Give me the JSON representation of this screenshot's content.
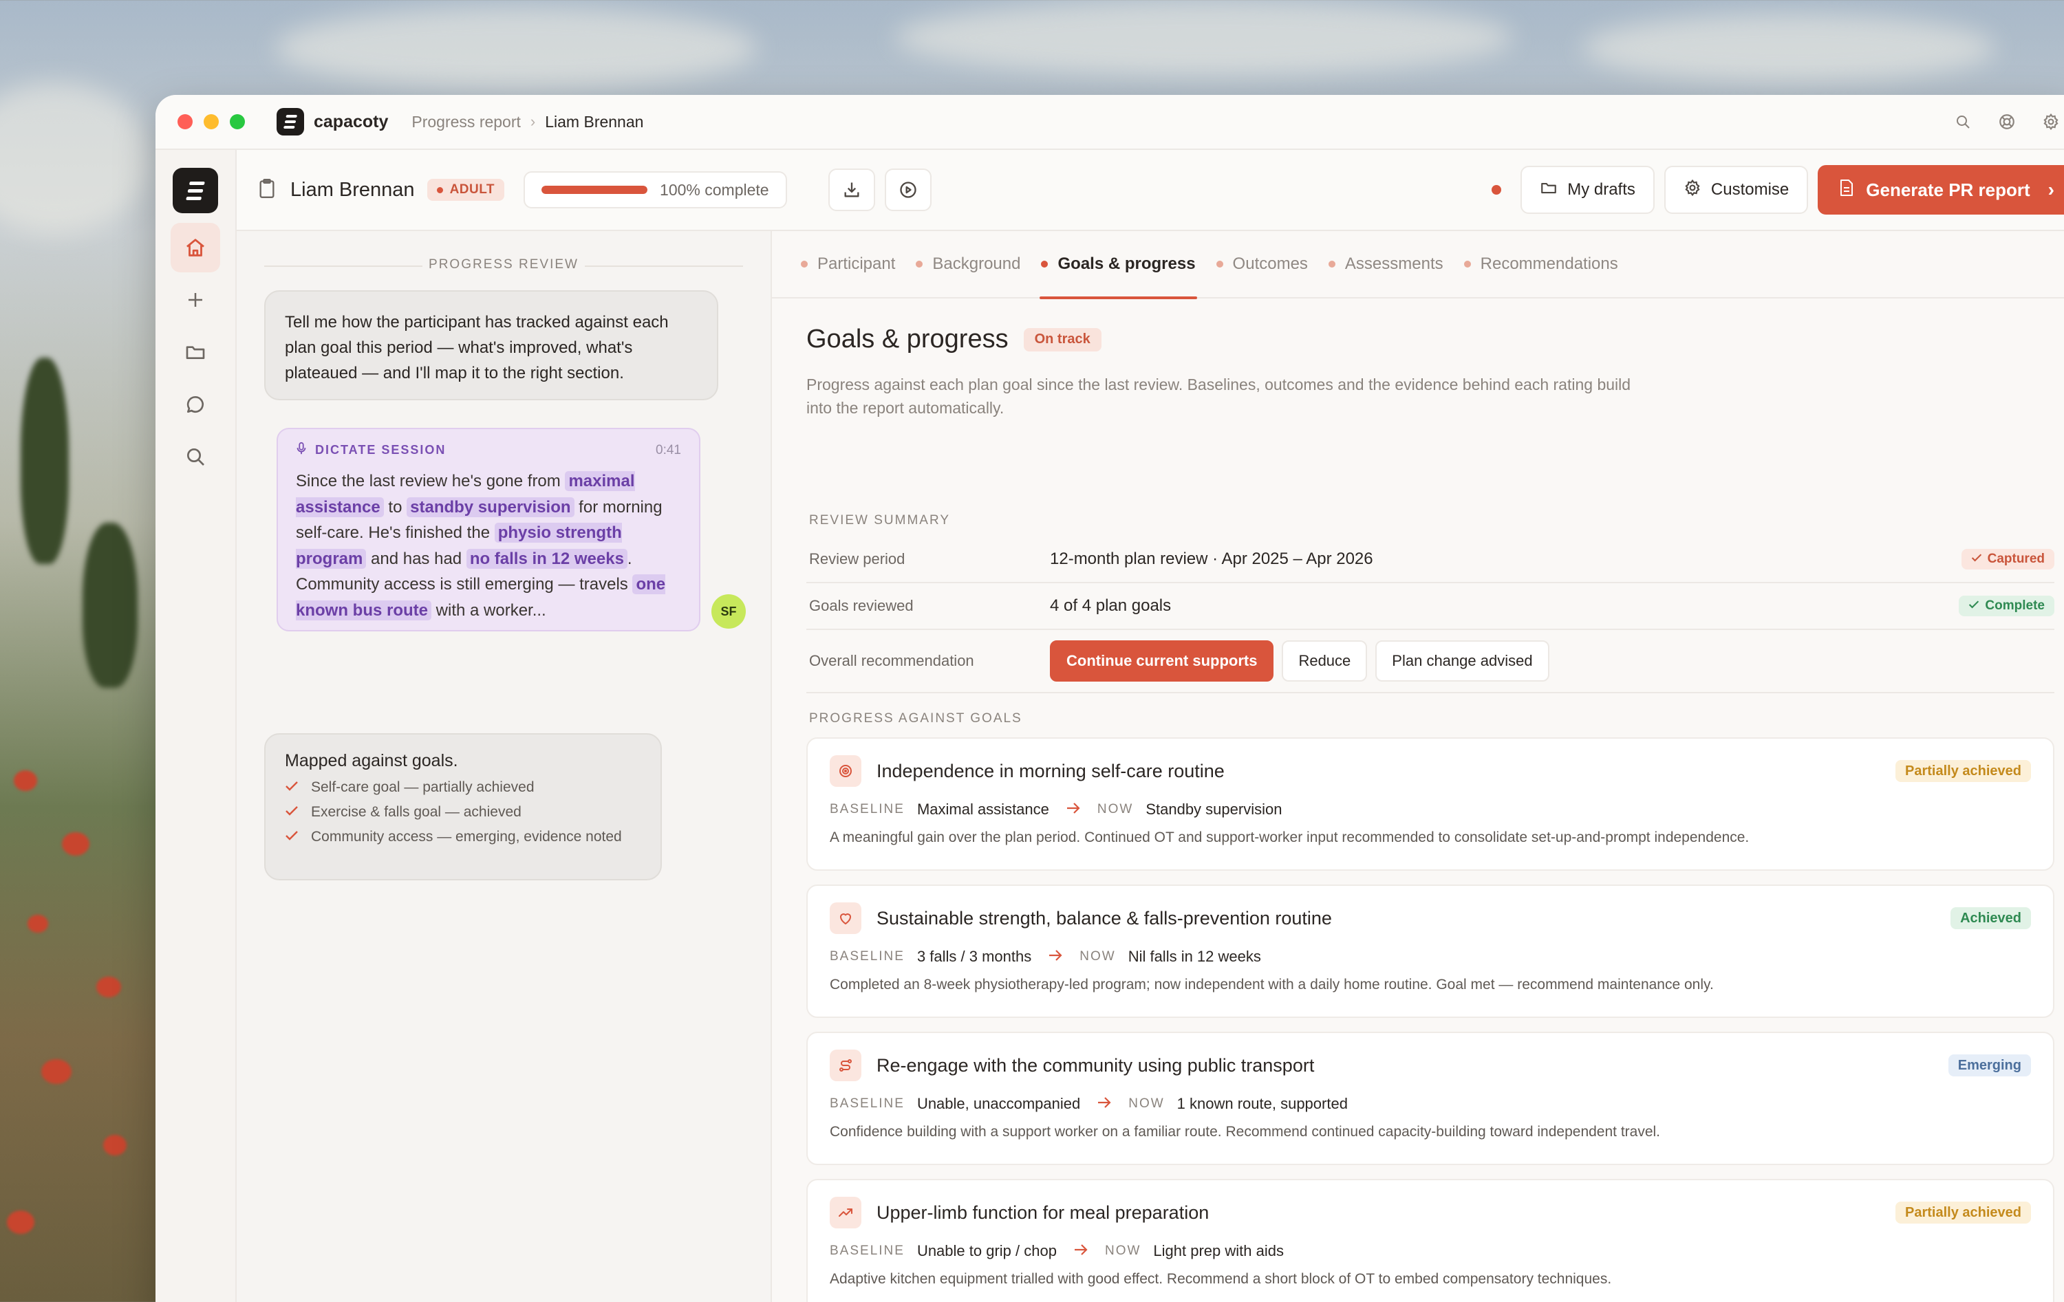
{
  "window": {
    "brand": "capacoty",
    "breadcrumb": [
      "Progress report",
      "Liam Brennan"
    ]
  },
  "header": {
    "participant": "Liam Brennan",
    "badge": "ADULT",
    "progress_percent": 100,
    "progress_text": "100% complete",
    "my_drafts": "My drafts",
    "customise": "Customise",
    "generate": "Generate PR report"
  },
  "chat": {
    "label": "PROGRESS REVIEW",
    "prompt": "Tell me how the participant has tracked against each plan goal this period — what's improved, what's plateaued — and I'll map it to the right section.",
    "dictate": {
      "label": "DICTATE SESSION",
      "time": "0:41",
      "t1": "Since the last review he's gone from ",
      "h1": "maximal assistance",
      "t2": " to ",
      "h2": "standby supervision",
      "t3": " for morning self-care. He's finished the ",
      "h3": "physio strength program",
      "t4": " and has had ",
      "h4": "no falls in 12 weeks",
      "t5": ". Community access is still emerging — travels ",
      "h5": "one known bus route",
      "t6": " with a worker..."
    },
    "avatar": "SF",
    "mapped": {
      "title": "Mapped against goals.",
      "items": [
        "Self-care goal — partially achieved",
        "Exercise & falls goal — achieved",
        "Community access — emerging, evidence noted"
      ]
    }
  },
  "tabs": [
    "Participant",
    "Background",
    "Goals & progress",
    "Outcomes",
    "Assessments",
    "Recommendations"
  ],
  "section": {
    "title": "Goals & progress",
    "status": "On track",
    "description": "Progress against each plan goal since the last review. Baselines, outcomes and the evidence behind each rating build into the report automatically.",
    "review_label": "REVIEW SUMMARY",
    "review_rows": [
      {
        "key": "Review period",
        "value": "12-month plan review · Apr 2025 – Apr 2026",
        "status": "Captured"
      },
      {
        "key": "Goals reviewed",
        "value": "4 of 4 plan goals",
        "status": "Complete"
      }
    ],
    "recommendation": {
      "key": "Overall recommendation",
      "options": [
        "Continue current supports",
        "Reduce",
        "Plan change advised"
      ]
    },
    "goals_label": "PROGRESS AGAINST GOALS",
    "baseline_label": "BASELINE",
    "now_label": "NOW",
    "goals": [
      {
        "icon": "target-icon",
        "title": "Independence in morning self-care routine",
        "status": "Partially achieved",
        "baseline": "Maximal assistance",
        "now": "Standby supervision",
        "desc": "A meaningful gain over the plan period. Continued OT and support-worker input recommended to consolidate set-up-and-prompt independence."
      },
      {
        "icon": "heart-icon",
        "title": "Sustainable strength, balance & falls-prevention routine",
        "status": "Achieved",
        "baseline": "3 falls / 3 months",
        "now": "Nil falls in 12 weeks",
        "desc": "Completed an 8-week physiotherapy-led program; now independent with a daily home routine. Goal met — recommend maintenance only."
      },
      {
        "icon": "route-icon",
        "title": "Re-engage with the community using public transport",
        "status": "Emerging",
        "baseline": "Unable, unaccompanied",
        "now": "1 known route, supported",
        "desc": "Confidence building with a support worker on a familiar route. Recommend continued capacity-building toward independent travel."
      },
      {
        "icon": "trend-up-icon",
        "title": "Upper-limb function for meal preparation",
        "status": "Partially achieved",
        "baseline": "Unable to grip / chop",
        "now": "Light prep with aids",
        "desc": "Adaptive kitchen equipment trialled with good effect. Recommend a short block of OT to embed compensatory techniques."
      }
    ]
  },
  "colors": {
    "accent": "#d9553c",
    "dictate_purple": "#7a4fb3",
    "avatar_green": "#c7e85b"
  }
}
